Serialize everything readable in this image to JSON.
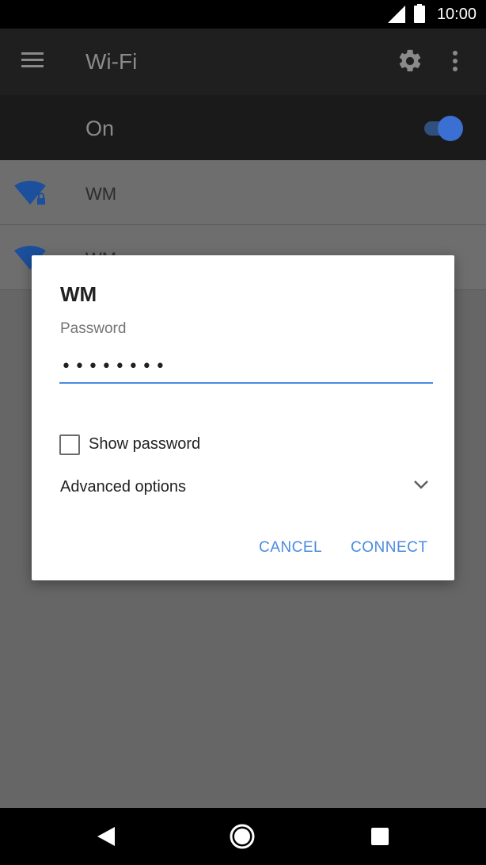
{
  "status_bar": {
    "time": "10:00",
    "icons": [
      "signal-icon",
      "battery-icon"
    ]
  },
  "toolbar": {
    "title": "Wi-Fi",
    "icons": [
      "menu-icon",
      "gear-icon",
      "more-vert-icon"
    ]
  },
  "wifi_switch": {
    "label": "On",
    "state": "on",
    "accent_color": "#3b6fd1"
  },
  "networks": [
    {
      "name": "WM",
      "icon": "wifi-lock-icon"
    },
    {
      "name": "WM",
      "icon": "wifi-icon"
    }
  ],
  "dialog": {
    "title": "WM",
    "password_label": "Password",
    "password_value": "••••••••",
    "show_password_label": "Show password",
    "show_password_checked": false,
    "advanced_options_label": "Advanced options",
    "cancel_label": "CANCEL",
    "connect_label": "CONNECT",
    "accent_color": "#4a8be0"
  },
  "nav_bar": {
    "icons": [
      "back-icon",
      "home-icon",
      "recents-icon"
    ]
  }
}
